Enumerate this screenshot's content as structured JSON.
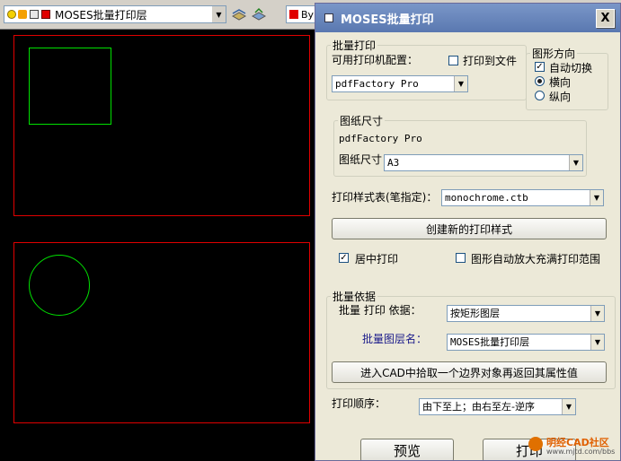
{
  "toolbar": {
    "layer_name": "MOSES批量打印层",
    "color_label": "By",
    "icons": [
      "bulb-icon",
      "sun-icon",
      "lock-icon",
      "layer-color-swatch",
      "layer-states-icon",
      "layer-previous-icon"
    ]
  },
  "colors": {
    "viewport_border": "#e00000",
    "geometry": "#00e000",
    "canvas_bg": "#000000",
    "titlebar": "#6a86c0"
  },
  "dialog": {
    "title": "MOSES批量打印",
    "close_label": "X",
    "batch_print": {
      "legend": "批量打印",
      "printer_config_label": "可用打印机配置：",
      "print_to_file_label": "打印到文件",
      "print_to_file_checked": false,
      "printer_value": "pdfFactory Pro"
    },
    "orientation": {
      "legend": "图形方向",
      "auto_switch_label": "自动切换",
      "auto_switch_checked": true,
      "landscape_label": "横向",
      "portrait_label": "纵向",
      "selected": "landscape"
    },
    "paper": {
      "legend": "图纸尺寸",
      "printer_name": "pdfFactory Pro",
      "size_label": "图纸尺寸",
      "size_value": "A3"
    },
    "style": {
      "label": "打印样式表(笔指定)：",
      "value": "monochrome.ctb",
      "create_button": "创建新的打印样式",
      "center_print_label": "居中打印",
      "center_print_checked": true,
      "auto_fit_label": "图形自动放大充满打印范围",
      "auto_fit_checked": false
    },
    "batch_basis": {
      "legend": "批量依据",
      "basis_label": "批量 打印 依据：",
      "basis_value": "按矩形图层",
      "layer_label": "批量图层名：",
      "layer_value": "MOSES批量打印层",
      "pick_button": "进入CAD中拾取一个边界对象再返回其属性值"
    },
    "order": {
      "label": "打印顺序：",
      "value": "由下至上；由右至左-逆序"
    },
    "preview_button": "预览",
    "print_button": "打印"
  },
  "watermark": {
    "title": "明经CAD社区",
    "url": "www.mjtd.com/bbs"
  }
}
